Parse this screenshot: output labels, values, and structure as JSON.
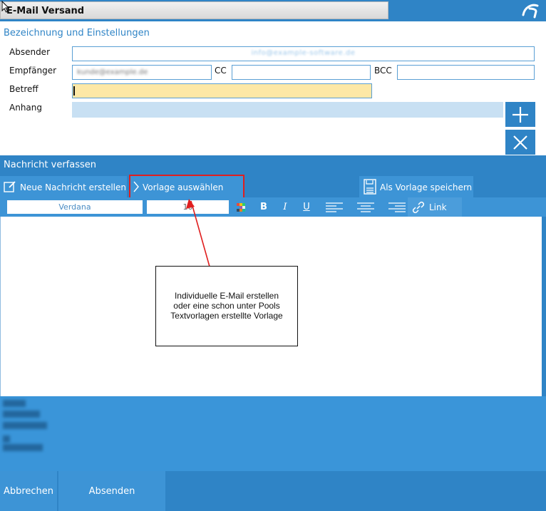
{
  "window": {
    "title": "E-Mail Versand"
  },
  "settings": {
    "heading": "Bezeichnung und Einstellungen",
    "sender_label": "Absender",
    "sender_value": "info@example-software.de",
    "recipient_label": "Empfänger",
    "recipient_value": "kunde@example.de",
    "cc_label": "CC",
    "cc_value": "",
    "bcc_label": "BCC",
    "bcc_value": "",
    "subject_label": "Betreff",
    "subject_value": "",
    "attachment_label": "Anhang",
    "add_icon": "plus-icon",
    "remove_icon": "close-icon"
  },
  "compose": {
    "heading": "Nachricht verfassen",
    "new_message_label": "Neue Nachricht erstellen",
    "choose_template_label": "Vorlage auswählen",
    "save_template_label": "Als Vorlage speichern",
    "font_value": "Verdana",
    "size_value": "10",
    "bold_label": "B",
    "italic_label": "I",
    "underline_label": "U",
    "link_label": "Link"
  },
  "callout": {
    "line1": "Individuelle E-Mail erstellen",
    "line2": "oder eine schon unter Pools",
    "line3": "Textvorlagen erstellte Vorlage"
  },
  "footer": {
    "cancel_label": "Abbrechen",
    "send_label": "Absenden"
  },
  "colors": {
    "accent": "#2f84c6",
    "subject_bg": "#fde8a6",
    "annotation": "#e01f1f"
  }
}
